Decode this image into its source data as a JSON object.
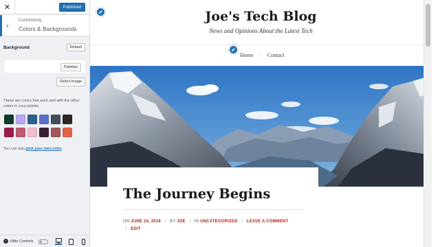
{
  "customizer": {
    "publish_label": "Published",
    "breadcrumb": "Customizing",
    "section_title": "Colors & Backgrounds",
    "background_label": "Background",
    "default_label": "Default",
    "palettes_label": "Palettes",
    "select_image_label": "Select Image",
    "palette_note": "These are colors that work well with the other colors in your palette:",
    "pick_prefix": "You can also",
    "pick_link": "pick your own color",
    "hide_controls_label": "Hide Controls",
    "swatches_row1": [
      "#0f3b2b",
      "#b9a7f0",
      "#2e5f8c",
      "#5a70c7",
      "#454c5a",
      "#2f2620"
    ],
    "swatches_row2": [
      "#9e1b4b",
      "#c05b74",
      "#f3bfd0",
      "#3a1f33",
      "#a3585a",
      "#e36447"
    ]
  },
  "site": {
    "title": "Joe's Tech Blog",
    "tagline": "News and Opinions About the Latest Tech",
    "nav": [
      "Home",
      "Contact"
    ],
    "nav_separator": "/"
  },
  "post": {
    "title": "The Journey Begins",
    "meta_on": "ON",
    "date": "JUNE 24, 2018",
    "meta_by": "BY",
    "author": "JOE",
    "meta_in": "IN",
    "category": "UNCATEGORIZED",
    "comment_link": "LEAVE A COMMENT",
    "edit_link": "EDIT",
    "separator": "/"
  },
  "colors": {
    "accent": "#2271b1",
    "post_link": "#b71c1c"
  }
}
